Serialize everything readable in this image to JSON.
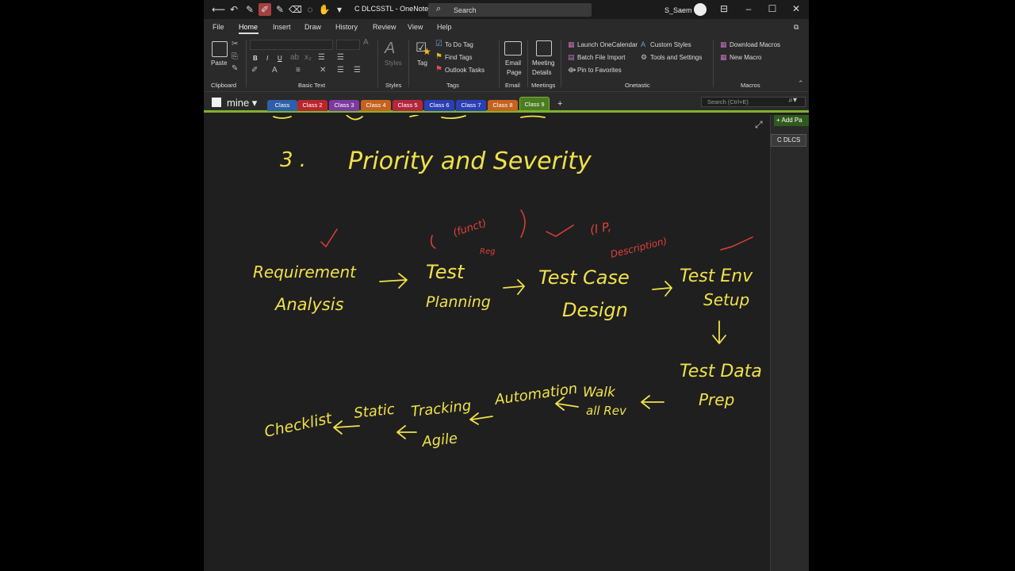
{
  "title_bar": {
    "window_title": "C DLCSSTL  -  OneNote",
    "search_label": "Search",
    "user_name": "S_Saem"
  },
  "menu": {
    "tabs": [
      "File",
      "Home",
      "Insert",
      "Draw",
      "History",
      "Review",
      "View",
      "Help"
    ],
    "active": "Home"
  },
  "ribbon": {
    "clipboard": {
      "paste": "Paste",
      "label": "Clipboard"
    },
    "basic_text": {
      "bold": "B",
      "italic": "I",
      "underline": "U",
      "label": "Basic Text"
    },
    "styles": {
      "button": "Styles",
      "label": "Styles"
    },
    "tags": {
      "tag": "Tag",
      "todo": "To Do Tag",
      "find": "Find Tags",
      "outlook": "Outlook Tasks",
      "label": "Tags"
    },
    "email": {
      "line1": "Email",
      "line2": "Page",
      "label": "Email"
    },
    "meetings": {
      "line1": "Meeting",
      "line2": "Details",
      "label": "Meetings"
    },
    "onetastic": {
      "launch": "Launch OneCalendar",
      "batch": "Batch File Import",
      "pin": "Pin to Favorites",
      "custom_styles": "Custom Styles",
      "tools": "Tools and Settings",
      "label": "Onetastic"
    },
    "macros": {
      "download": "Download Macros",
      "new": "New Macro",
      "label": "Macros"
    }
  },
  "notebook": {
    "name": "mine",
    "sections": [
      {
        "label": "Class",
        "color": "#2e5fa8"
      },
      {
        "label": "Class 2",
        "color": "#b8262c"
      },
      {
        "label": "Class 3",
        "color": "#7b3a9e"
      },
      {
        "label": "Class 4",
        "color": "#c4621e"
      },
      {
        "label": "Class 5",
        "color": "#b3263c"
      },
      {
        "label": "Class 6",
        "color": "#2b3fb5"
      },
      {
        "label": "Class 7",
        "color": "#2b3fb5"
      },
      {
        "label": "Class 8",
        "color": "#c4621e"
      },
      {
        "label": "Class 9",
        "color": "#4a7d1f"
      }
    ],
    "add_section": "+",
    "search_placeholder": "Search (Ctrl+E)"
  },
  "page_pane": {
    "add_page": "+ Add Pa",
    "page": "C DLCS"
  },
  "ink": {
    "heading_number": "3 .",
    "heading": "Priority and Severity",
    "req_1": "Requirement",
    "req_2": "Analysis",
    "plan_1": "Test",
    "plan_2": "Planning",
    "design_1": "Test Case",
    "design_2": "Design",
    "env_1": "Test Env",
    "env_2": "Setup",
    "data_1": "Test Data",
    "data_2": "Prep",
    "walk_1": "Walk",
    "walk_2": "all Rev",
    "automation": "Automation",
    "tracking": "Tracking",
    "agile": "Agile",
    "static": "Static",
    "checklist": "Checklist",
    "note_funct": "(funct)",
    "note_reg": "Reg",
    "note_ip": "(I P,",
    "note_desc": "Description)"
  },
  "colors": {
    "ink_yellow": "#f0e14a",
    "ink_red": "#e0403a",
    "accent_green": "#7fb22f"
  },
  "icons": [
    "back-icon",
    "undo-icon",
    "pen-icon",
    "highlighter-icon",
    "lasso-icon",
    "hand-icon",
    "search-icon",
    "expand-icon"
  ]
}
